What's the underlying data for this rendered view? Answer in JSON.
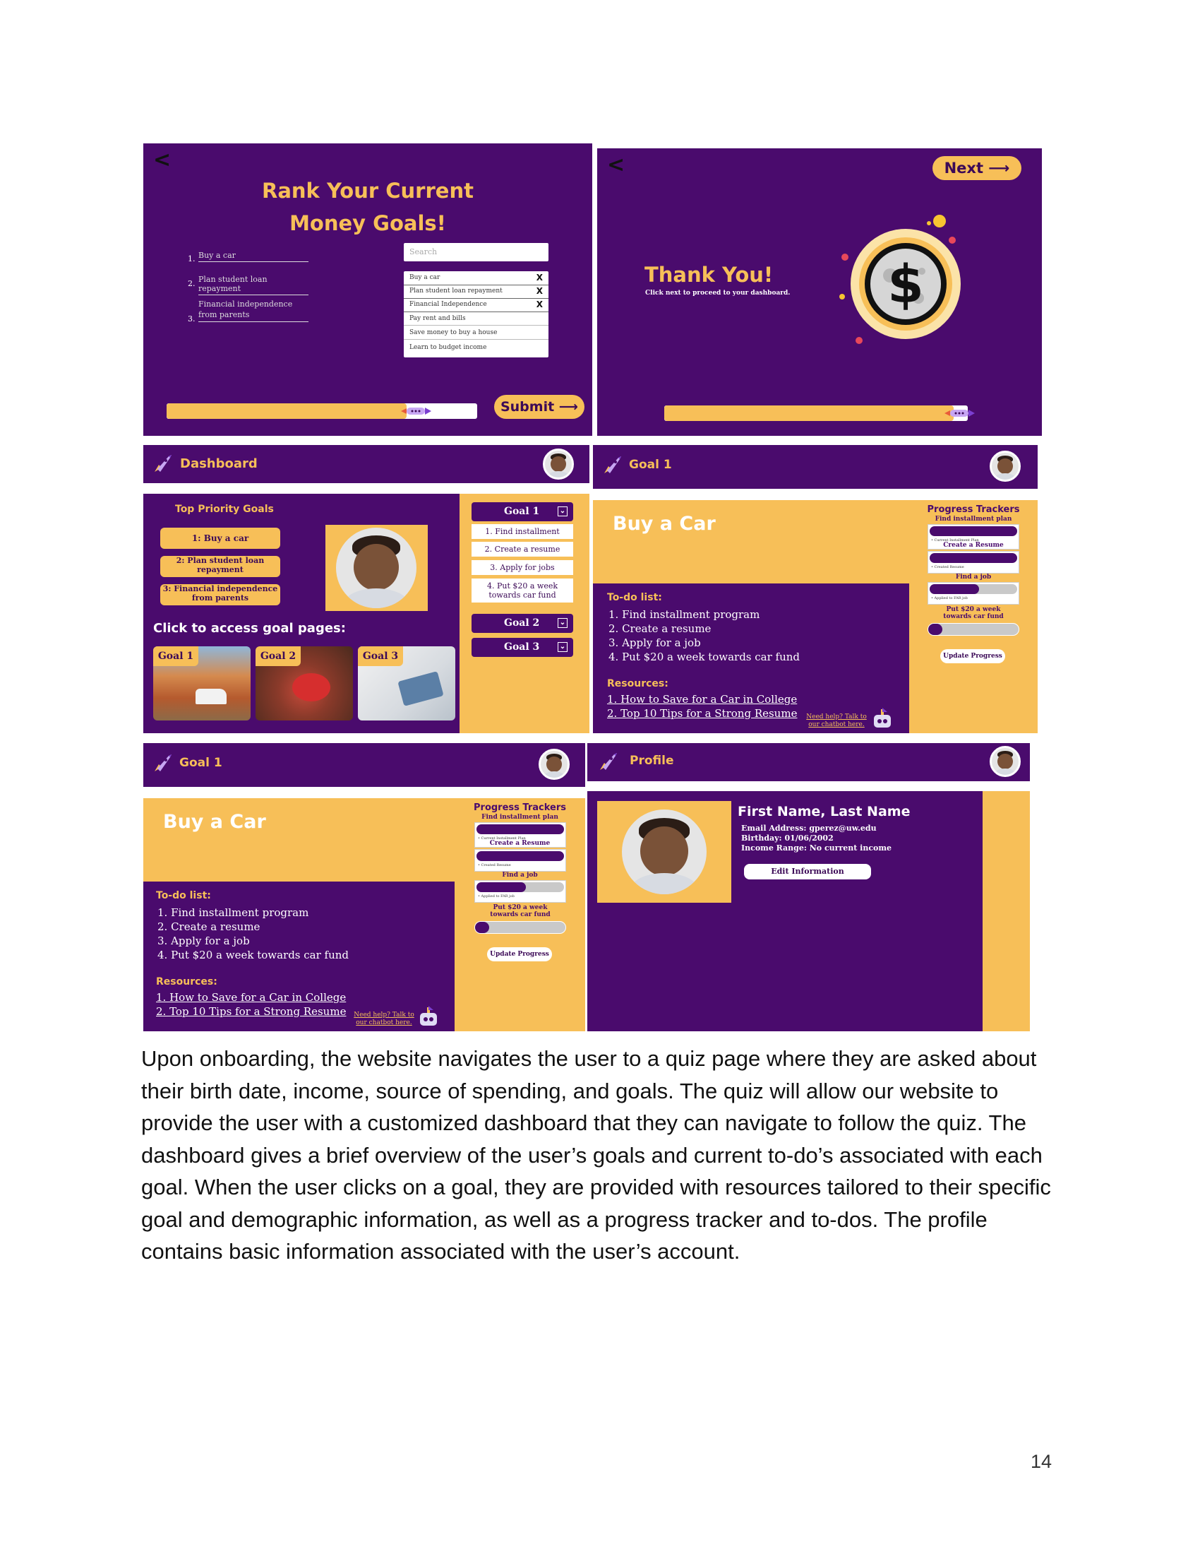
{
  "quiz": {
    "back": "<",
    "title_line1": "Rank Your Current",
    "title_line2": "Money Goals!",
    "ranks": [
      "1.",
      "2.",
      "3."
    ],
    "ranked": [
      "Buy a car",
      "Plan student loan repayment",
      "Financial independence from parents"
    ],
    "search_placeholder": "Search",
    "options": [
      "Buy a car",
      "Plan student loan repayment",
      "Financial Independence",
      "Pay rent and bills",
      "Save money to buy a house",
      "Learn to budget income"
    ],
    "remove_mark": "X",
    "submit": "Submit ⟶"
  },
  "thanks": {
    "back": "<",
    "next": "Next ⟶",
    "title": "Thank You!",
    "subtitle": "Click next to proceed to your dashboard.",
    "dollar": "$"
  },
  "dashboard": {
    "nav_title": "Dashboard",
    "top_goals_title": "Top Priority Goals",
    "top_goals": [
      "1: Buy a car",
      "2: Plan student loan repayment",
      "3: Financial independence from parents"
    ],
    "click_text": "Click to access goal pages:",
    "goal_cards": [
      "Goal 1",
      "Goal 2",
      "Goal 3"
    ],
    "goal1_tab": "Goal 1",
    "goal1_items": [
      "1. Find installment program",
      "2. Create a resume",
      "3. Apply for jobs",
      "4. Put $20 a week towards car fund"
    ],
    "goal2_tab": "Goal 2",
    "goal3_tab": "Goal 3"
  },
  "goal_page": {
    "nav_title": "Goal 1",
    "title": "Buy a Car",
    "todo_label": "To-do list:",
    "todos": [
      "1. Find installment program",
      "2. Create a resume",
      "3. Apply for a job",
      "4. Put $20 a week towards car fund"
    ],
    "resources_label": "Resources:",
    "resources": [
      "1. How to Save for a Car in College",
      "2. Top 10 Tips for a Strong Resume"
    ],
    "help_text": "Need help? Talk to our chatbot here.",
    "trackers_title": "Progress Trackers",
    "trackers": [
      {
        "label": "Find installment plan",
        "note": "• Current Installment Plan",
        "progress": 1.0
      },
      {
        "label": "Create a Resume",
        "note": "• Created Resume",
        "progress": 1.0
      },
      {
        "label": "Find a job",
        "note": "• Applied to FAR job",
        "progress": 0.55
      },
      {
        "label": "Put $20 a week towards car fund",
        "note": "",
        "progress": 0.1
      }
    ],
    "update_button": "Update Progress"
  },
  "profile": {
    "nav_title": "Profile",
    "name": "First Name, Last Name",
    "email": "Email Address: gperez@uw.edu",
    "birthday": "Birthday: 01/06/2002",
    "income": "Income Range: No current income",
    "edit_button": "Edit Information"
  },
  "body_text": "Upon onboarding, the website navigates the user to a quiz page where they are asked about their birth date, income, source of spending, and goals. The quiz will allow our website to provide the user with a customized dashboard that they can navigate to follow the quiz. The dashboard gives a brief overview of the user’s goals and current to-do’s associated with each goal. When the user clicks on a goal, they are provided with resources tailored to their specific goal and demographic information, as well as a progress tracker and to-dos. The profile contains basic information associated with the user’s account.",
  "page_number": "14",
  "colors": {
    "purple": "#4a0b6d",
    "yellow": "#f7bf58"
  }
}
